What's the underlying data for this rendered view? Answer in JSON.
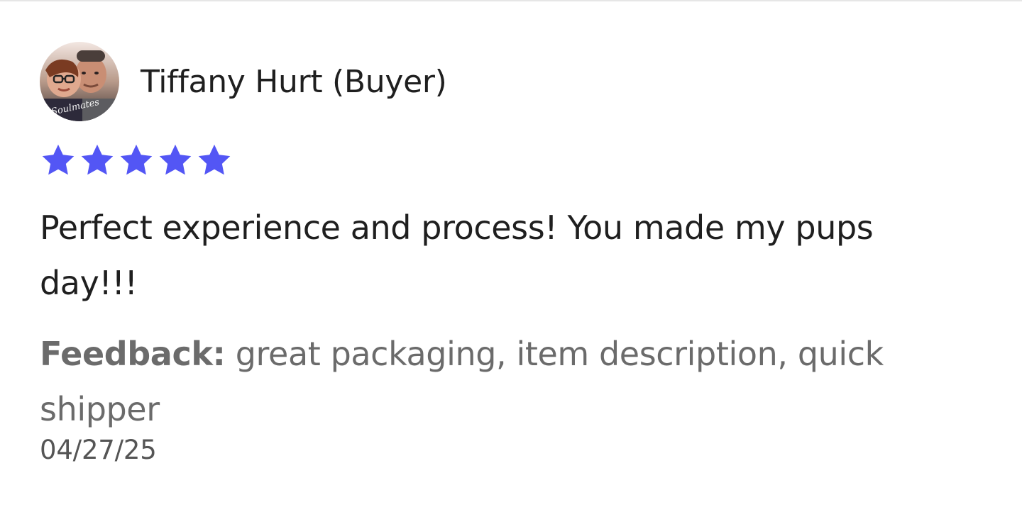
{
  "review": {
    "reviewer_name": "Tiffany Hurt (Buyer)",
    "avatar_watermark": "Soulmates",
    "rating": 5,
    "rating_max": 5,
    "star_color": "#5356f5",
    "text": "Perfect experience and process! You made my pups day!!!",
    "feedback_label": "Feedback:",
    "feedback_value": " great packaging, item description, quick shipper",
    "date": "04/27/25"
  }
}
